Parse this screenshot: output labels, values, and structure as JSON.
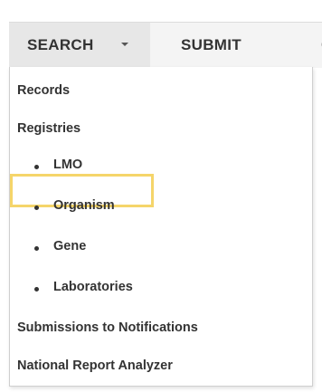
{
  "nav": {
    "search_label": "SEARCH",
    "submit_label": "SUBMIT"
  },
  "menu": {
    "records": "Records",
    "registries": "Registries",
    "registry_items": [
      "LMO",
      "Organism",
      "Gene",
      "Laboratories"
    ],
    "submissions": "Submissions to Notifications",
    "national_report": "National Report Analyzer"
  },
  "colors": {
    "highlight_border": "#f5d56a",
    "nav_background": "#f4f4f4",
    "active_tab_background": "#e7e7e7",
    "text": "#333333"
  }
}
